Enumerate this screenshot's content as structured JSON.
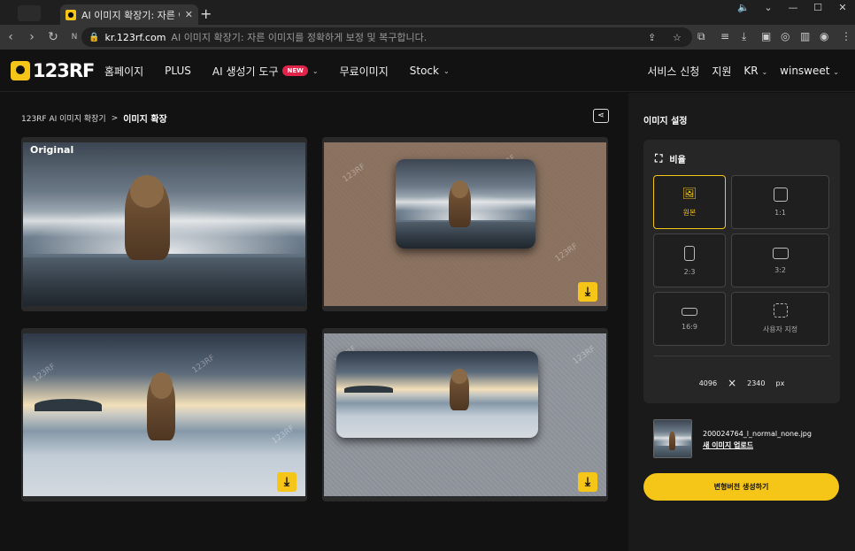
{
  "browser": {
    "tab_title": "AI 이미지 확장기: 자른 이미",
    "url_host": "kr.123rf.com",
    "url_rest": "AI 이미지 확장기: 자른 이미지를 정확하게 보정 및 복구합니다."
  },
  "header": {
    "logo": "123RF",
    "nav": {
      "home": "홈페이지",
      "plus": "PLUS",
      "ai_tools": "AI 생성기 도구",
      "new_badge": "NEW",
      "free_images": "무료이미지",
      "stock": "Stock"
    },
    "right": {
      "service_apply": "서비스 신청",
      "support": "지원",
      "lang": "KR",
      "user": "winsweet"
    }
  },
  "breadcrumb": {
    "parent": "123RF AI 이미지 확장기",
    "sep": ">",
    "current": "이미지 확장"
  },
  "results": {
    "original_label": "Original",
    "watermark": "123RF"
  },
  "settings": {
    "title": "이미지 설정",
    "ratio_title": "비율",
    "options": {
      "original": "원본",
      "r1_1": "1:1",
      "r2_3": "2:3",
      "r3_2": "3:2",
      "r16_9": "16:9",
      "custom": "사용자 지정"
    },
    "selected": "원본",
    "width": "4096",
    "times": "×",
    "height": "2340",
    "unit": "px"
  },
  "upload": {
    "filename": "200024764_l_normal_none.jpg",
    "new_upload": "새 이미지 업로드"
  },
  "generate_button": "변형버전 생성하기",
  "colors": {
    "accent": "#f5c518",
    "badge": "#e0244a",
    "background": "#121212",
    "panel": "#1a1a1a"
  }
}
